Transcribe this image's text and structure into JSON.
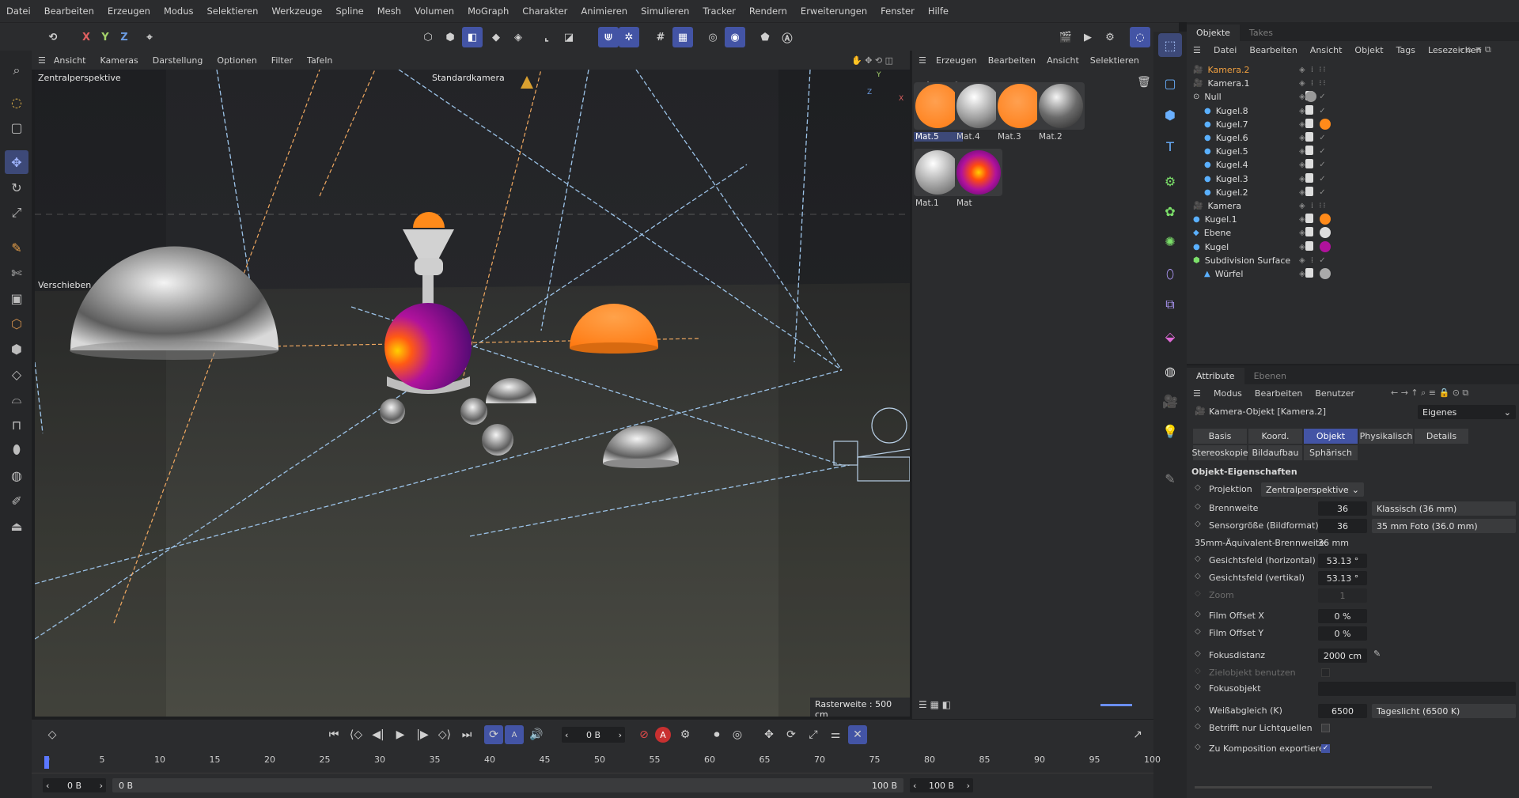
{
  "menu": [
    "Datei",
    "Bearbeiten",
    "Erzeugen",
    "Modus",
    "Selektieren",
    "Werkzeuge",
    "Spline",
    "Mesh",
    "Volumen",
    "MoGraph",
    "Charakter",
    "Animieren",
    "Simulieren",
    "Tracker",
    "Rendern",
    "Erweiterungen",
    "Fenster",
    "Hilfe"
  ],
  "toolbar": {
    "x": "X",
    "y": "Y",
    "z": "Z"
  },
  "viewport": {
    "menu": [
      "Ansicht",
      "Kameras",
      "Darstellung",
      "Optionen",
      "Filter",
      "Tafeln"
    ],
    "perspective": "Zentralperspektive",
    "camera": "Standardkamera",
    "tool": "Verschieben",
    "grid": "Rasterweite : 500 cm",
    "axis_y": "Y",
    "axis_z": "Z",
    "axis_x": "X"
  },
  "materials": {
    "menu": [
      "Erzeugen",
      "Bearbeiten",
      "Ansicht",
      "Selektieren"
    ],
    "items": [
      {
        "name": "Mat.5",
        "color": "#ff8c2a"
      },
      {
        "name": "Mat.4",
        "color": "#b9b9b9"
      },
      {
        "name": "Mat.3",
        "color": "#ff8a20"
      },
      {
        "name": "Mat.2",
        "color": "#8d8d8d"
      },
      {
        "name": "Mat.1",
        "color": "#c7c7c7"
      },
      {
        "name": "Mat",
        "color": "#9c1fb0"
      }
    ]
  },
  "objects": {
    "tabs": [
      "Objekte",
      "Takes"
    ],
    "menu": [
      "Datei",
      "Bearbeiten",
      "Ansicht",
      "Objekt",
      "Tags",
      "Lesezeichen"
    ],
    "rows": [
      {
        "name": "Kamera.2",
        "icon": "camera",
        "hl": true
      },
      {
        "name": "Kamera.1",
        "icon": "camera"
      },
      {
        "name": "Null",
        "icon": "null"
      },
      {
        "name": "Kugel.8",
        "icon": "sphere"
      },
      {
        "name": "Kugel.7",
        "icon": "sphere"
      },
      {
        "name": "Kugel.6",
        "icon": "sphere"
      },
      {
        "name": "Kugel.5",
        "icon": "sphere"
      },
      {
        "name": "Kugel.4",
        "icon": "sphere"
      },
      {
        "name": "Kugel.3",
        "icon": "sphere"
      },
      {
        "name": "Kugel.2",
        "icon": "sphere"
      },
      {
        "name": "Kamera",
        "icon": "camera"
      },
      {
        "name": "Kugel.1",
        "icon": "sphere"
      },
      {
        "name": "Ebene",
        "icon": "plane"
      },
      {
        "name": "Kugel",
        "icon": "sphere"
      },
      {
        "name": "Subdivision Surface",
        "icon": "subd"
      },
      {
        "name": "Würfel",
        "icon": "cube"
      }
    ]
  },
  "attributes": {
    "tabs": [
      "Attribute",
      "Ebenen"
    ],
    "menu": [
      "Modus",
      "Bearbeiten",
      "Benutzer"
    ],
    "object": "Kamera-Objekt [Kamera.2]",
    "preset": "Eigenes",
    "tabs_row1": [
      "Basis",
      "Koord.",
      "Objekt",
      "Physikalisch",
      "Details"
    ],
    "tabs_row2": [
      "Stereoskopie",
      "Bildaufbau",
      "Sphärisch"
    ],
    "section": "Objekt-Eigenschaften",
    "projection_label": "Projektion",
    "projection": "Zentralperspektive",
    "focal_label": "Brennweite",
    "focal": "36",
    "focal_preset": "Klassisch (36 mm)",
    "sensor_label": "Sensorgröße (Bildformat)",
    "sensor": "36",
    "sensor_preset": "35 mm Foto (36.0 mm)",
    "equiv_label": "35mm-Äquivalent-Brennweite:",
    "equiv": "36 mm",
    "fovh_label": "Gesichtsfeld (horizontal)",
    "fovh": "53.13 °",
    "fovv_label": "Gesichtsfeld (vertikal)",
    "fovv": "53.13 °",
    "zoom_label": "Zoom",
    "zoom": "1",
    "offx_label": "Film Offset X",
    "offx": "0 %",
    "offy_label": "Film Offset Y",
    "offy": "0 %",
    "focus_label": "Fokusdistanz",
    "focus": "2000 cm",
    "target_label": "Zielobjekt benutzen",
    "focusobj_label": "Fokusobjekt",
    "wb_label": "Weißabgleich (K)",
    "wb": "6500",
    "wb_preset": "Tageslicht (6500 K)",
    "lights_label": "Betrifft nur Lichtquellen",
    "export_label": "Zu Komposition exportieren"
  },
  "timeline": {
    "frame": "0 B",
    "start": "0 B",
    "start2": "0 B",
    "end": "100 B",
    "end2": "100 B",
    "ticks": [
      "0",
      "5",
      "10",
      "15",
      "20",
      "25",
      "30",
      "35",
      "40",
      "45",
      "50",
      "55",
      "60",
      "65",
      "70",
      "75",
      "80",
      "85",
      "90",
      "95",
      "100"
    ]
  }
}
